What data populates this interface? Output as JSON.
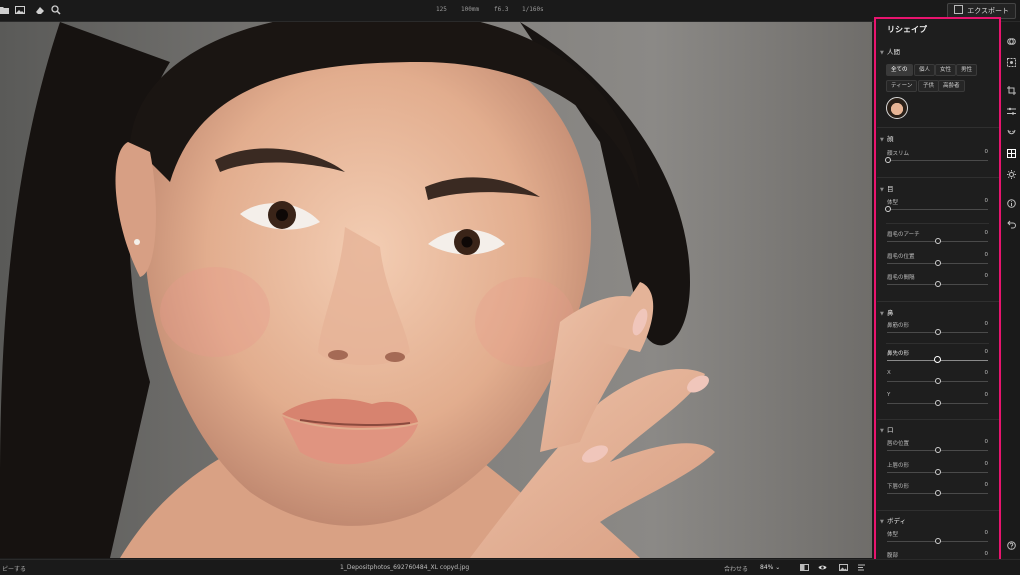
{
  "toolbar": {
    "exif": [
      "125",
      "100mm",
      "f6.3",
      "1/160s"
    ],
    "export_label": "エクスポート"
  },
  "photo": {
    "filename": "1_Depositphotos_692760484_XL copyd.jpg"
  },
  "bottombar": {
    "copy_label": "ピーする",
    "fit_label": "合わせる",
    "zoom_label": "84% ⌄"
  },
  "panel": {
    "title": "リシェイプ",
    "sections": {
      "people": "人間",
      "face": "顔",
      "eyes": "目",
      "nose": "鼻",
      "mouth": "口",
      "body": "ボディ"
    },
    "chips": [
      "全ての",
      "個人",
      "女性",
      "男性",
      "ティーン",
      "子供",
      "高齢者"
    ],
    "sliders": [
      {
        "label": "顔スリム",
        "value": "0"
      },
      {
        "label": "体型",
        "value": "0"
      },
      {
        "label": "眉毛のアーチ",
        "value": "0"
      },
      {
        "label": "眉毛の位置",
        "value": "0"
      },
      {
        "label": "眉毛の間隔",
        "value": "0"
      },
      {
        "label": "鼻筋の形",
        "value": "0"
      },
      {
        "label": "鼻先の形",
        "value": "0"
      },
      {
        "label": "X",
        "value": "0"
      },
      {
        "label": "Y",
        "value": "0"
      },
      {
        "label": "唇の位置",
        "value": "0"
      },
      {
        "label": "上唇の形",
        "value": "0"
      },
      {
        "label": "下唇の形",
        "value": "0"
      },
      {
        "label": "体型",
        "value": "0"
      },
      {
        "label": "腹部",
        "value": "0"
      }
    ]
  },
  "colors": {
    "highlight": "#e8146e",
    "panel_bg": "#1e1e1e"
  }
}
